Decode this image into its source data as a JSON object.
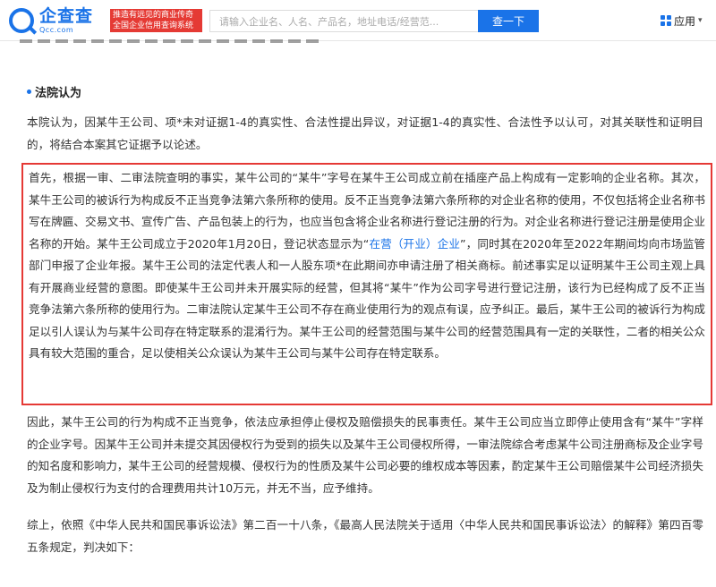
{
  "header": {
    "logo_cn": "企查查",
    "logo_en": "Qcc.com",
    "slogan_line1": "推造有远见的商业传奇",
    "slogan_line2": "全国企业信用查询系统",
    "search_placeholder": "请输入企业名、人名、产品名，地址电话/经营范...",
    "search_button": "查一下",
    "app_menu": "应用"
  },
  "section": {
    "title": "法院认为"
  },
  "paragraphs": {
    "p1": "本院认为，因某牛王公司、项*未对证据1-4的真实性、合法性提出异议，对证据1-4的真实性、合法性予以认可，对其关联性和证明目的，将结合本案其它证据予以论述。",
    "p2_before_link": "首先，根据一审、二审法院查明的事实，某牛公司的“某牛”字号在某牛王公司成立前在插座产品上构成有一定影响的企业名称。其次，某牛王公司的被诉行为构成反不正当竞争法第六条所称的使用。反不正当竞争法第六条所称的对企业名称的使用，不仅包括将企业名称书写在牌匾、交易文书、宣传广告、产品包装上的行为，也应当包含将企业名称进行登记注册的行为。对企业名称进行登记注册是使用企业名称的开始。某牛王公司成立于2020年1月20日，登记状态显示为“",
    "p2_link": "在营（开业）企业",
    "p2_after_link": "”，同时其在2020年至2022年期间均向市场监管部门申报了企业年报。某牛王公司的法定代表人和一人股东项*在此期间亦申请注册了相关商标。前述事实足以证明某牛王公司主观上具有开展商业经营的意图。即使某牛王公司并未开展实际的经营，但其将“某牛”作为公司字号进行登记注册，该行为已经构成了反不正当竞争法第六条所称的使用行为。二审法院认定某牛王公司不存在商业使用行为的观点有误，应予纠正。最后，某牛王公司的被诉行为构成足以引人误认为与某牛公司存在特定联系的混淆行为。某牛王公司的经营范围与某牛公司的经营范围具有一定的关联性，二者的相关公众具有较大范围的重合，足以使相关公众误认为某牛王公司与某牛公司存在特定联系。",
    "p3": "因此，某牛王公司的行为构成不正当竞争，依法应承担停止侵权及赔偿损失的民事责任。某牛王公司应当立即停止使用含有“某牛”字样的企业字号。因某牛王公司并未提交其因侵权行为受到的损失以及某牛王公司侵权所得，一审法院综合考虑某牛公司注册商标及企业字号的知名度和影响力，某牛王公司的经营规模、侵权行为的性质及某牛公司必要的维权成本等因素，酌定某牛王公司赔偿某牛公司经济损失及为制止侵权行为支付的合理费用共计10万元，并无不当，应予维持。",
    "p4": "综上，依照《中华人民共和国民事诉讼法》第二百一十八条，《最高人民法院关于适用〈中华人民共和国民事诉讼法〉的解释》第四百零五条规定，判决如下："
  },
  "colors": {
    "brand_blue": "#1a73e8",
    "highlight_red": "#e53935"
  }
}
